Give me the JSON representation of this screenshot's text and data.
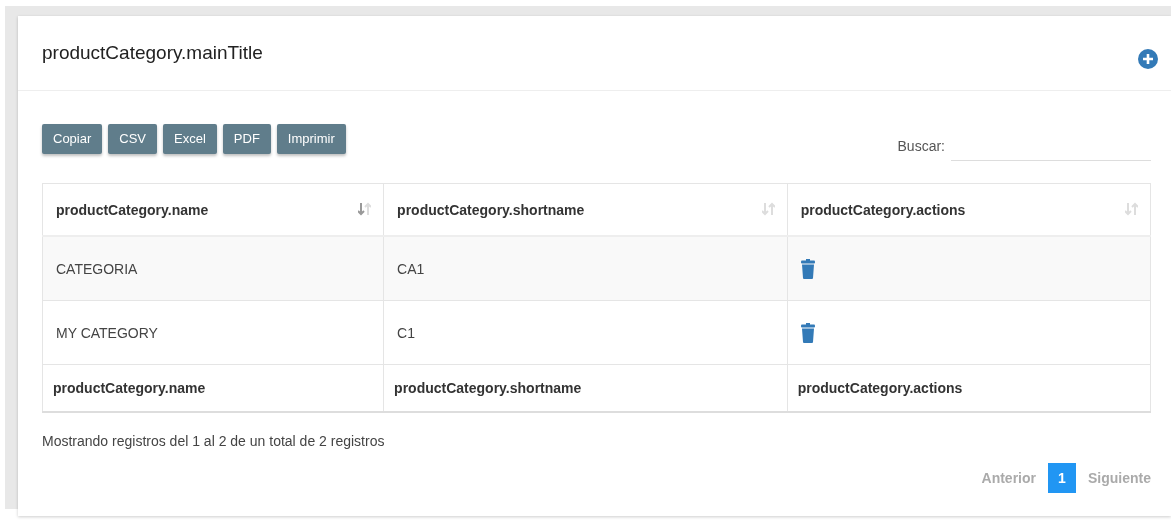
{
  "card": {
    "title": "productCategory.mainTitle"
  },
  "export_buttons": [
    "Copiar",
    "CSV",
    "Excel",
    "PDF",
    "Imprimir"
  ],
  "search": {
    "label": "Buscar:"
  },
  "table": {
    "columns": [
      {
        "label": "productCategory.name",
        "sorted": true
      },
      {
        "label": "productCategory.shortname",
        "sorted": false
      },
      {
        "label": "productCategory.actions",
        "sorted": false
      }
    ],
    "rows": [
      {
        "name": "CATEGORIA",
        "shortname": "CA1"
      },
      {
        "name": "MY CATEGORY",
        "shortname": "C1"
      }
    ],
    "footer": [
      "productCategory.name",
      "productCategory.shortname",
      "productCategory.actions"
    ]
  },
  "info": "Mostrando registros del 1 al 2 de un total de 2 registros",
  "pagination": {
    "previous": "Anterior",
    "pages": [
      {
        "label": "1",
        "selected": true
      }
    ],
    "next": "Siguiente"
  }
}
